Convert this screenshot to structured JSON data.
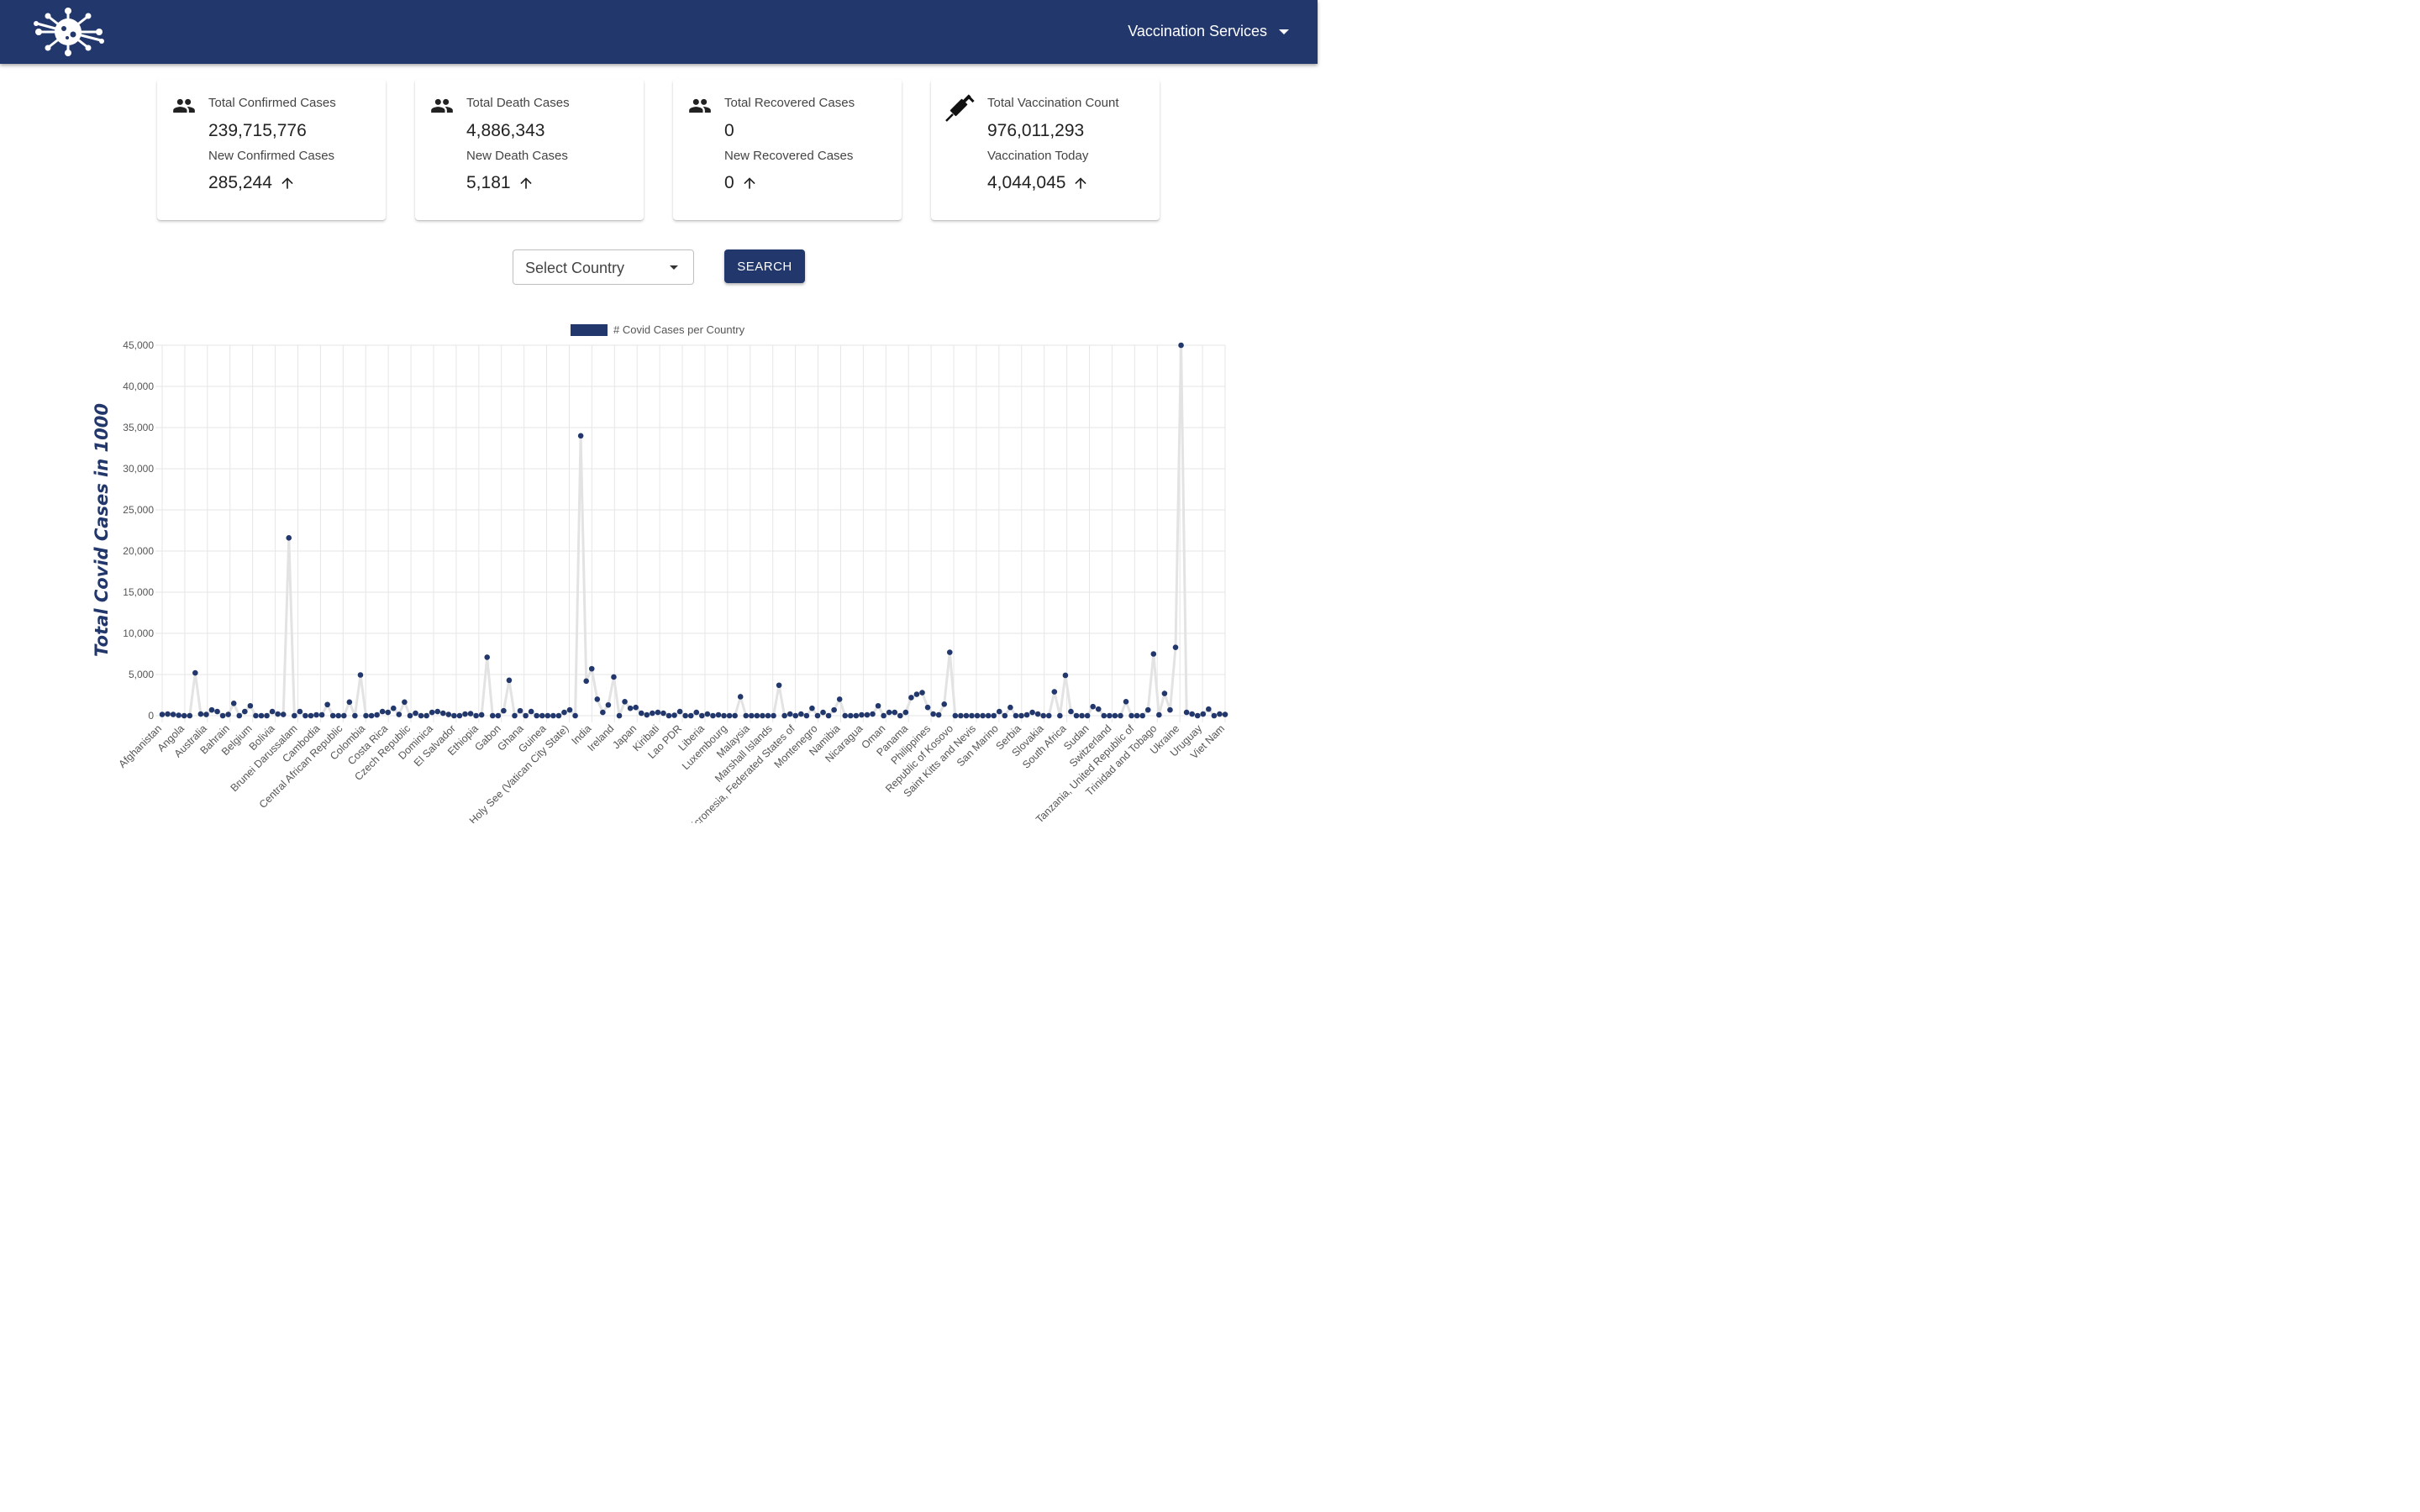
{
  "header": {
    "menu_label": "Vaccination Services"
  },
  "colors": {
    "brand": "#22376b",
    "line": "#e3e3e3",
    "grid": "#e6e6e6"
  },
  "cards": [
    {
      "icon": "people-icon",
      "title": "Total Confirmed Cases",
      "total": "239,715,776",
      "new_label": "New Confirmed Cases",
      "new_value": "285,244",
      "trend_icon": "arrow-up-icon"
    },
    {
      "icon": "people-icon",
      "title": "Total Death Cases",
      "total": "4,886,343",
      "new_label": "New Death Cases",
      "new_value": "5,181",
      "trend_icon": "arrow-up-icon"
    },
    {
      "icon": "people-icon",
      "title": "Total Recovered Cases",
      "total": "0",
      "new_label": "New Recovered Cases",
      "new_value": "0",
      "trend_icon": "arrow-up-icon"
    },
    {
      "icon": "syringe-icon",
      "title": "Total Vaccination Count",
      "total": "976,011,293",
      "new_label": "Vaccination Today",
      "new_value": "4,044,045",
      "trend_icon": "arrow-up-icon"
    }
  ],
  "filter": {
    "select_placeholder": "Select Country",
    "search_label": "SEARCH"
  },
  "chart_data": {
    "type": "line",
    "legend": "# Covid Cases per Country",
    "legend_position": "top",
    "ylabel": "Total Covid Cases in 1000",
    "ylim": [
      0,
      45000
    ],
    "yticks": [
      "0",
      "5,000",
      "10,000",
      "15,000",
      "20,000",
      "25,000",
      "30,000",
      "35,000",
      "40,000",
      "45,000"
    ],
    "grid": true,
    "x_tick_labels": [
      "Afghanistan",
      "Angola",
      "Australia",
      "Bahrain",
      "Belgium",
      "Bolivia",
      "Brunei Darussalam",
      "Cambodia",
      "Central African Republic",
      "Colombia",
      "Costa Rica",
      "Czech Republic",
      "Dominica",
      "El Salvador",
      "Ethiopia",
      "Gabon",
      "Ghana",
      "Guinea",
      "Holy See (Vatican City State)",
      "India",
      "Ireland",
      "Japan",
      "Kiribati",
      "Lao PDR",
      "Liberia",
      "Luxembourg",
      "Malaysia",
      "Marshall Islands",
      "Micronesia, Federated States of",
      "Montenegro",
      "Namibia",
      "Nicaragua",
      "Oman",
      "Panama",
      "Philippines",
      "Republic of Kosovo",
      "Saint Kitts and Nevis",
      "San Marino",
      "Serbia",
      "Slovakia",
      "South Africa",
      "Sudan",
      "Switzerland",
      "Tanzania, United Republic of",
      "Trinidad and Tobago",
      "Ukraine",
      "Uruguay",
      "Viet Nam"
    ],
    "values": [
      150,
      200,
      150,
      50,
      0,
      0,
      5200,
      200,
      150,
      700,
      500,
      0,
      150,
      1500,
      0,
      500,
      1200,
      0,
      0,
      0,
      500,
      200,
      150,
      21600,
      0,
      500,
      0,
      0,
      100,
      100,
      1350,
      0,
      0,
      0,
      1650,
      0,
      4950,
      0,
      0,
      100,
      500,
      400,
      900,
      150,
      1650,
      0,
      300,
      0,
      0,
      400,
      500,
      300,
      150,
      0,
      0,
      200,
      250,
      0,
      100,
      7100,
      0,
      0,
      600,
      4300,
      0,
      600,
      0,
      500,
      0,
      0,
      0,
      0,
      0,
      400,
      700,
      0,
      34000,
      4200,
      5700,
      2000,
      400,
      1300,
      4700,
      0,
      1700,
      900,
      1000,
      300,
      100,
      300,
      400,
      300,
      0,
      50,
      500,
      0,
      0,
      400,
      0,
      200,
      0,
      100,
      0,
      0,
      0,
      2300,
      0,
      0,
      0,
      0,
      0,
      0,
      3700,
      0,
      200,
      0,
      200,
      0,
      900,
      0,
      400,
      0,
      700,
      2000,
      0,
      0,
      0,
      100,
      100,
      200,
      1200,
      0,
      400,
      400,
      0,
      400,
      2200,
      2600,
      2800,
      1000,
      200,
      100,
      1400,
      7700,
      0,
      0,
      0,
      0,
      0,
      0,
      0,
      0,
      500,
      0,
      1000,
      0,
      0,
      100,
      400,
      200,
      0,
      0,
      2900,
      0,
      4900,
      500,
      0,
      0,
      0,
      1100,
      800,
      0,
      0,
      0,
      0,
      1700,
      0,
      0,
      0,
      700,
      7500,
      100,
      2700,
      700,
      8300,
      45000,
      400,
      200,
      0,
      200,
      800,
      0,
      200,
      150
    ]
  }
}
